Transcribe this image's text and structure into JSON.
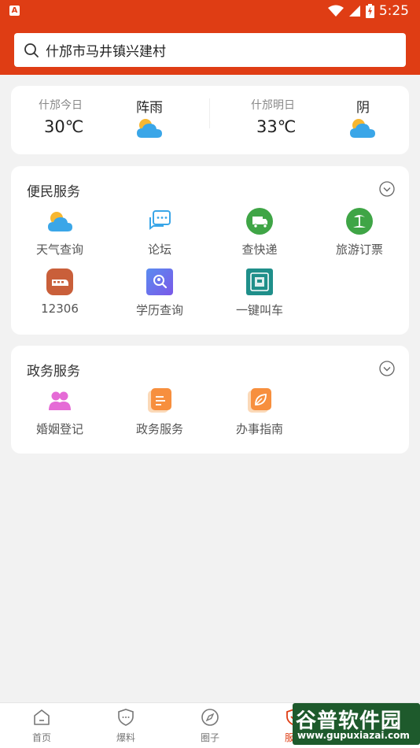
{
  "status": {
    "time": "5:25",
    "left_icon_text": "A"
  },
  "search": {
    "text": "什邡市马井镇兴建村"
  },
  "weather": {
    "today": {
      "label": "什邡今日",
      "temp": "30℃",
      "condition": "阵雨",
      "icon": "partly-cloudy-icon"
    },
    "tomorrow": {
      "label": "什邡明日",
      "temp": "33℃",
      "condition": "阴",
      "icon": "partly-cloudy-icon"
    }
  },
  "convenience": {
    "title": "便民服务",
    "items": [
      {
        "label": "天气查询",
        "icon": "weather-icon"
      },
      {
        "label": "论坛",
        "icon": "forum-chat-icon"
      },
      {
        "label": "查快递",
        "icon": "delivery-truck-icon"
      },
      {
        "label": "旅游订票",
        "icon": "travel-island-icon"
      },
      {
        "label": "12306",
        "icon": "train-icon"
      },
      {
        "label": "学历查询",
        "icon": "education-search-icon"
      },
      {
        "label": "一键叫车",
        "icon": "taxi-icon"
      }
    ]
  },
  "government": {
    "title": "政务服务",
    "items": [
      {
        "label": "婚姻登记",
        "icon": "marriage-couple-icon"
      },
      {
        "label": "政务服务",
        "icon": "gov-document-icon"
      },
      {
        "label": "办事指南",
        "icon": "guide-leaf-icon"
      }
    ]
  },
  "bottom_nav": [
    {
      "label": "首页",
      "icon": "home-icon"
    },
    {
      "label": "爆料",
      "icon": "shield-report-icon"
    },
    {
      "label": "圈子",
      "icon": "compass-icon"
    },
    {
      "label": "服务",
      "icon": "service-icon"
    }
  ],
  "watermark": {
    "main": "谷普软件园",
    "url": "www.gupuxiazai.com"
  },
  "colors": {
    "brand": "#df3d14",
    "background": "#f2f2f2"
  }
}
